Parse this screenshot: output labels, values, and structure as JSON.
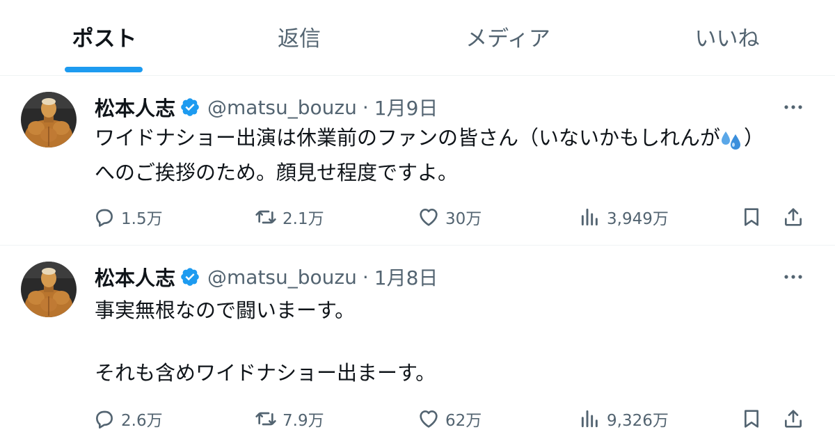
{
  "tabs": [
    {
      "label": "ポスト",
      "active": true
    },
    {
      "label": "返信",
      "active": false
    },
    {
      "label": "メディア",
      "active": false
    },
    {
      "label": "いいね",
      "active": false
    }
  ],
  "posts": [
    {
      "display_name": "松本人志",
      "handle": "@matsu_bouzu",
      "separator": "·",
      "date": "1月9日",
      "text_line1": "ワイドナショー出演は休業前のファンの皆さん（いないかもしれんが",
      "text_line1_end": "）",
      "text_line2": "へのご挨拶のため。顔見せ程度ですよ。",
      "emoji": "sweat-droplets",
      "replies": "1.5万",
      "reposts": "2.1万",
      "likes": "30万",
      "views": "3,949万"
    },
    {
      "display_name": "松本人志",
      "handle": "@matsu_bouzu",
      "separator": "·",
      "date": "1月8日",
      "text_line1": "事実無根なので闘いまーす。",
      "text_line2": "それも含めワイドナショー出まーす。",
      "replies": "2.6万",
      "reposts": "7.9万",
      "likes": "62万",
      "views": "9,326万"
    }
  ],
  "colors": {
    "accent": "#1d9bf0",
    "text": "#0f1419",
    "secondary": "#536471",
    "divider": "#eff3f4"
  },
  "icons": {
    "reply": "reply-icon",
    "repost": "repost-icon",
    "like": "like-icon",
    "views": "views-icon",
    "bookmark": "bookmark-icon",
    "share": "share-icon",
    "more": "more-icon",
    "verified": "verified-badge-icon"
  }
}
